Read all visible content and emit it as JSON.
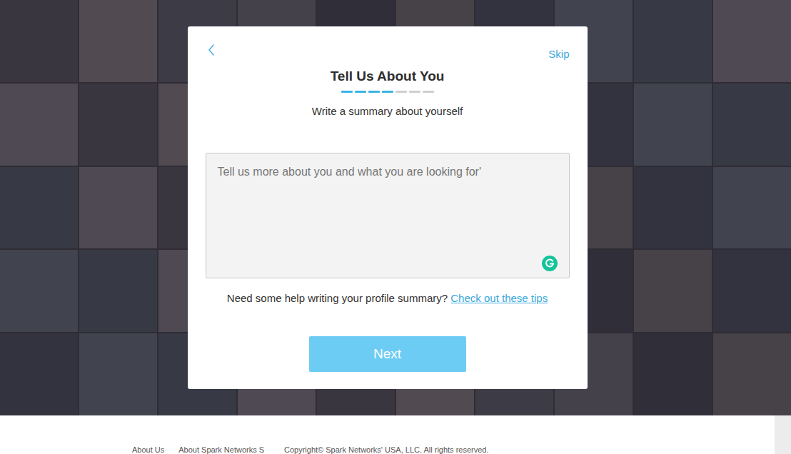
{
  "dialog": {
    "skip": "Skip",
    "title": "Tell Us About You",
    "progress": [
      {
        "done": true
      },
      {
        "done": true
      },
      {
        "done": true
      },
      {
        "done": true
      },
      {
        "done": false
      },
      {
        "done": false
      },
      {
        "done": false
      }
    ],
    "subtitle": "Write a summary about yourself",
    "summary": {
      "placeholder": "Tell us more about you and what you are looking for'"
    },
    "help": {
      "text": "Need some help writing your profile summary?",
      "link": "Check out these tips"
    },
    "next": {
      "label": "Next",
      "disabled": true
    }
  },
  "footer": {
    "links": [
      "About Us",
      "About Spark Networks S"
    ],
    "copyright": "Copyright©  Spark Networks' USA, LLC. All rights reserved."
  }
}
